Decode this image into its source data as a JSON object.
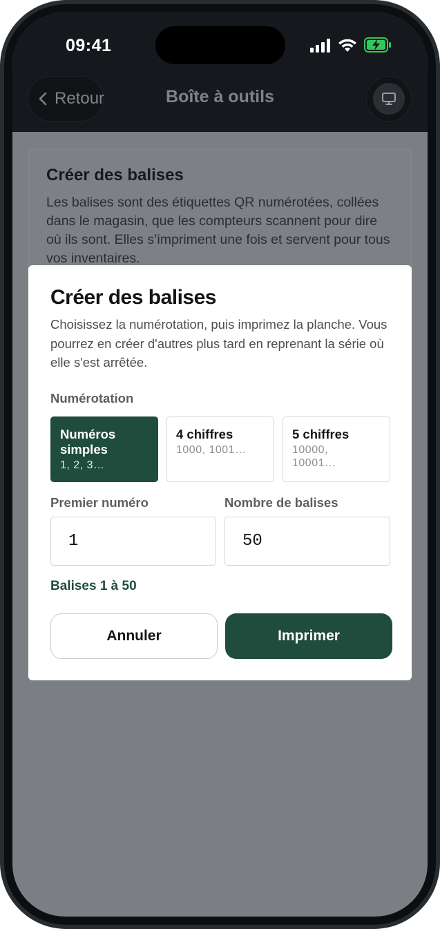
{
  "status_bar": {
    "time": "09:41"
  },
  "nav": {
    "back_label": "Retour",
    "title": "Boîte à outils"
  },
  "background_card": {
    "title": "Créer des balises",
    "body": "Les balises sont des étiquettes QR numérotées, collées dans le magasin, que les compteurs scannent pour dire où ils sont. Elles s’impriment une fois et servent pour tous vos inventaires."
  },
  "modal": {
    "title": "Créer des balises",
    "description": "Choisissez la numérotation, puis imprimez la planche. Vous pourrez en créer d'autres plus tard en reprenant la série où elle s'est arrêtée.",
    "numbering_label": "Numérotation",
    "options": [
      {
        "title": "Numéros simples",
        "example": "1, 2, 3…",
        "selected": true
      },
      {
        "title": "4 chiffres",
        "example": "1000, 1001…",
        "selected": false
      },
      {
        "title": "5 chiffres",
        "example": "10000, 10001…",
        "selected": false
      }
    ],
    "first_number_label": "Premier numéro",
    "first_number_value": "1",
    "count_label": "Nombre de balises",
    "count_value": "50",
    "range_text": "Balises 1 à 50",
    "cancel_label": "Annuler",
    "print_label": "Imprimer"
  },
  "colors": {
    "accent": "#204c3d",
    "header_bg": "#15191d",
    "overlay": "#7b7e82",
    "battery": "#34c759"
  },
  "icons": [
    "chevron-left-icon",
    "monitor-icon",
    "signal-icon",
    "wifi-icon",
    "battery-charging-icon"
  ]
}
